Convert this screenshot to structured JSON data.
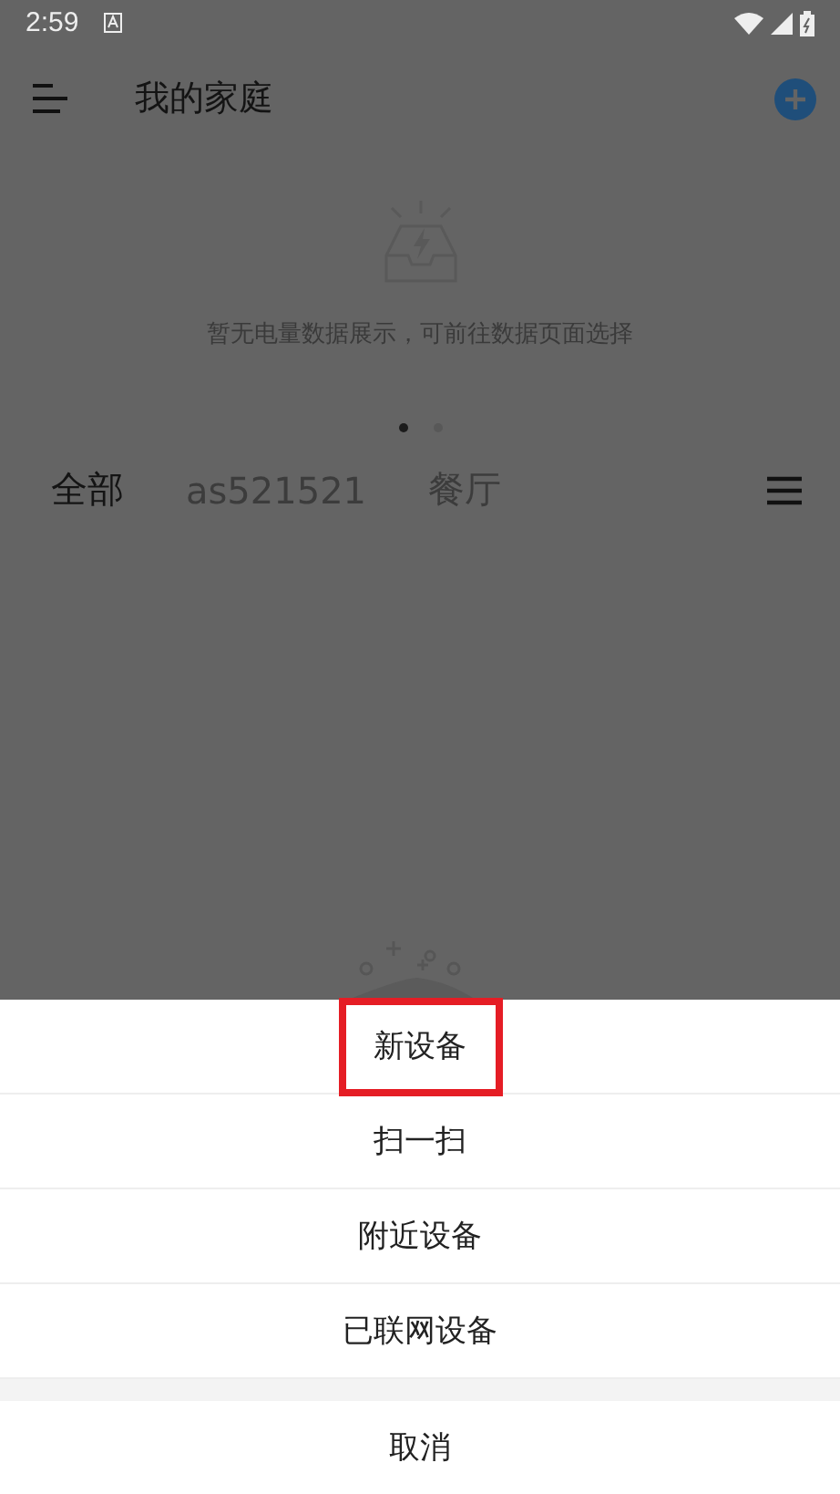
{
  "status_bar": {
    "time": "2:59"
  },
  "app_bar": {
    "title": "我的家庭"
  },
  "energy_panel": {
    "empty_message": "暂无电量数据展示，可前往数据页面选择",
    "pages": [
      {
        "selected": true
      },
      {
        "selected": false
      }
    ]
  },
  "room_tabs": [
    {
      "label": "全部",
      "selected": true
    },
    {
      "label": "as521521",
      "selected": false
    },
    {
      "label": "餐厅",
      "selected": false
    }
  ],
  "action_sheet": {
    "options": [
      {
        "label": "新设备",
        "highlighted": true
      },
      {
        "label": "扫一扫",
        "highlighted": false
      },
      {
        "label": "附近设备",
        "highlighted": false
      },
      {
        "label": "已联网设备",
        "highlighted": false
      }
    ],
    "cancel": "取消"
  }
}
